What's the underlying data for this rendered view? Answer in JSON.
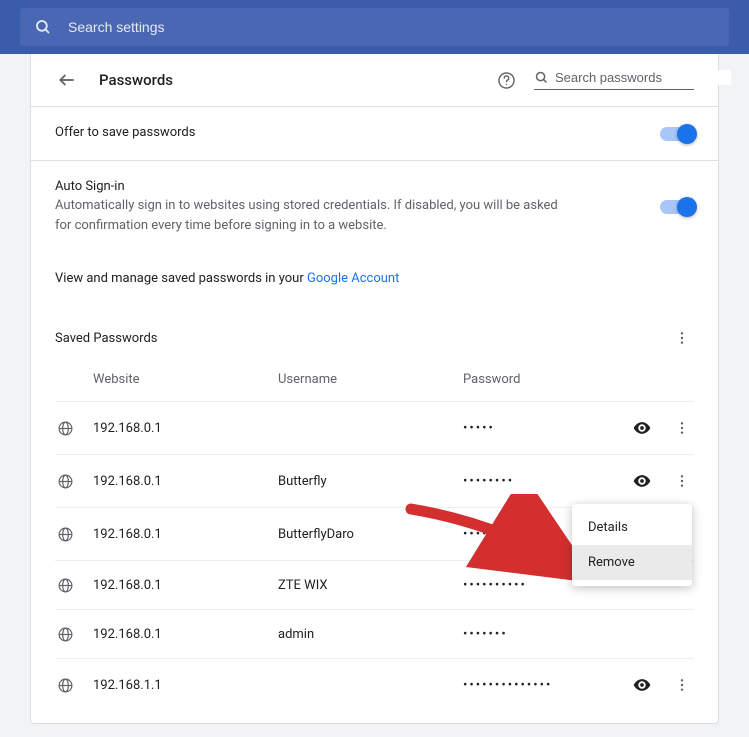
{
  "topSearch": {
    "placeholder": "Search settings"
  },
  "header": {
    "title": "Passwords",
    "searchPlaceholder": "Search passwords"
  },
  "offer": {
    "title": "Offer to save passwords"
  },
  "autoSignin": {
    "title": "Auto Sign-in",
    "desc": "Automatically sign in to websites using stored credentials. If disabled, you will be asked for confirmation every time before signing in to a website."
  },
  "linkPrefix": "View and manage saved passwords in your ",
  "linkText": "Google Account",
  "saved": {
    "title": "Saved Passwords"
  },
  "columns": {
    "site": "Website",
    "user": "Username",
    "pass": "Password"
  },
  "rows": [
    {
      "site": "192.168.0.1",
      "user": "",
      "pass": "•••••"
    },
    {
      "site": "192.168.0.1",
      "user": "Butterfly",
      "pass": "••••••••"
    },
    {
      "site": "192.168.0.1",
      "user": "ButterflyDaro",
      "pass": "•••••••••"
    },
    {
      "site": "192.168.0.1",
      "user": "ZTE WIX",
      "pass": "••••••••••"
    },
    {
      "site": "192.168.0.1",
      "user": "admin",
      "pass": "•••••••"
    },
    {
      "site": "192.168.1.1",
      "user": "",
      "pass": "••••••••••••••"
    }
  ],
  "menu": {
    "details": "Details",
    "remove": "Remove"
  }
}
